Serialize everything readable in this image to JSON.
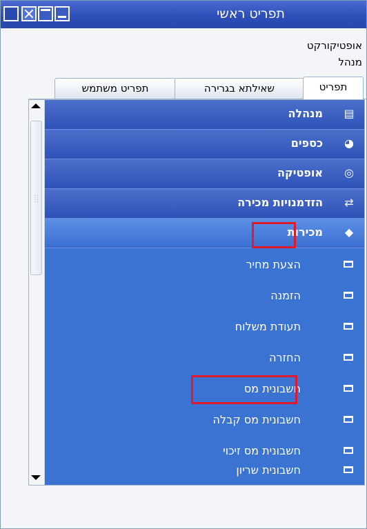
{
  "window": {
    "title": "תפריט ראשי",
    "line1": "אופטיקורקט",
    "line2": "מנהל"
  },
  "tabs": [
    {
      "label": "תפריט"
    },
    {
      "label": "שאילתא בגרירה"
    },
    {
      "label": "תפריט משתמש"
    }
  ],
  "categories": [
    {
      "label": "מנהלה",
      "icon": "document-icon"
    },
    {
      "label": "כספים",
      "icon": "globe-icon"
    },
    {
      "label": "אופטיקה",
      "icon": "eye-icon"
    },
    {
      "label": "הזדמנויות מכירה",
      "icon": "swap-icon"
    },
    {
      "label": "מכירות",
      "icon": "tag-icon"
    }
  ],
  "items": [
    {
      "label": "הצעת מחיר"
    },
    {
      "label": "הזמנה"
    },
    {
      "label": "תעודת משלוח"
    },
    {
      "label": "החזרה"
    },
    {
      "label": "חשבונית מס"
    },
    {
      "label": "חשבונית מס קבלה"
    },
    {
      "label": "חשבונית מס זיכוי"
    },
    {
      "label": "חשבונית שריון"
    }
  ],
  "colors": {
    "highlight": "#e0192c",
    "list_bg": "#3a73d2"
  }
}
